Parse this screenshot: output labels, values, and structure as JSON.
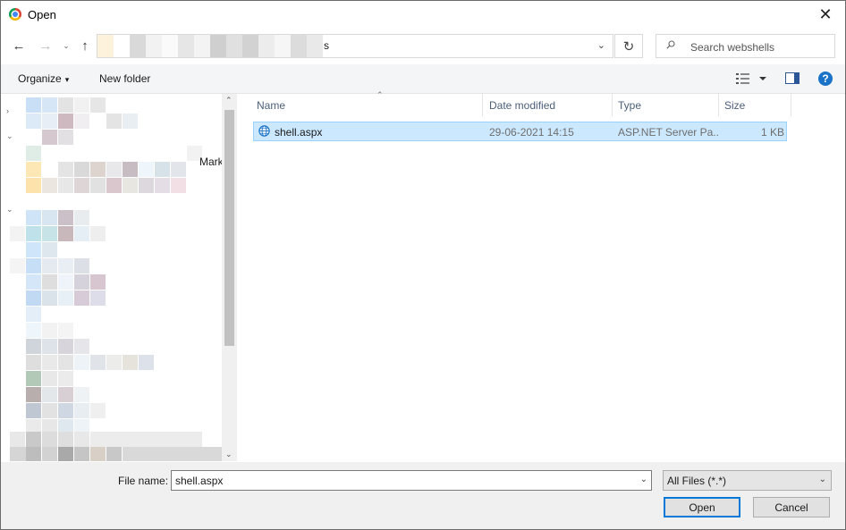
{
  "window": {
    "title": "Open",
    "close_glyph": "✕"
  },
  "nav": {
    "back_glyph": "←",
    "forward_glyph": "→",
    "recent_glyph": "⌄",
    "up_glyph": "↑",
    "address_visible_text": "s",
    "refresh_glyph": "↻",
    "search_placeholder": "Search webshells"
  },
  "toolbar": {
    "organize_label": "Organize",
    "organize_caret": "▾",
    "new_folder_label": "New folder",
    "help_glyph": "?"
  },
  "navpane": {
    "partial_label": "Marke"
  },
  "columns": {
    "name": "Name",
    "date_modified": "Date modified",
    "type": "Type",
    "size": "Size"
  },
  "files": [
    {
      "name": "shell.aspx",
      "date_modified": "29-06-2021 14:15",
      "type": "ASP.NET Server Pa...",
      "size": "1 KB",
      "icon": "globe-icon",
      "selected": true
    }
  ],
  "bottom": {
    "file_name_label": "File name:",
    "file_name_value": "shell.aspx",
    "file_type_value": "All Files (*.*)",
    "open_label": "Open",
    "cancel_label": "Cancel"
  },
  "colors": {
    "selection_bg": "#cce8ff",
    "selection_border": "#99d1ff",
    "accent": "#0078d7"
  }
}
